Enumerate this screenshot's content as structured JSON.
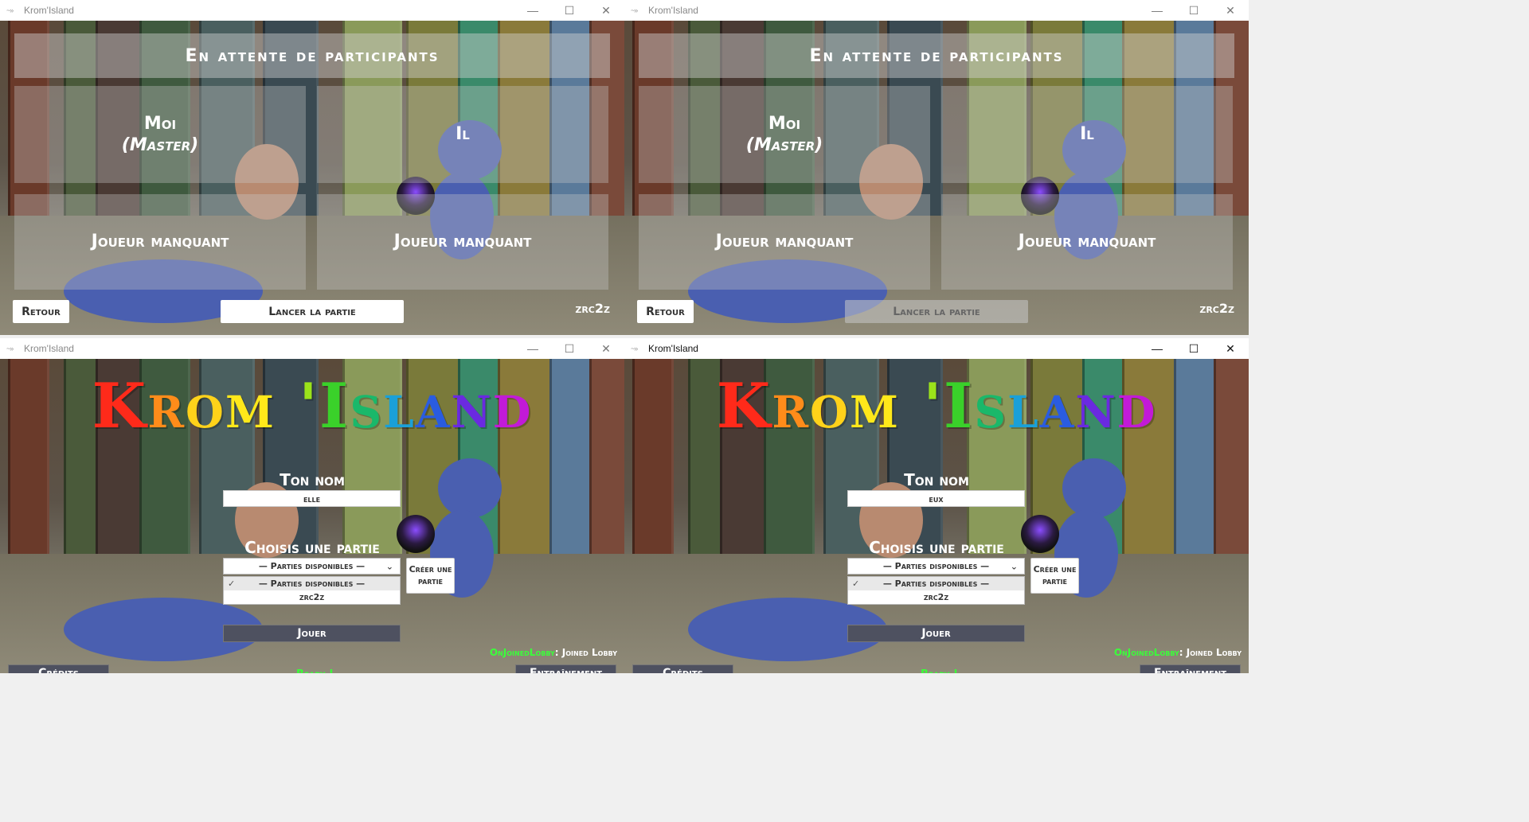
{
  "app_title": "Krom'Island",
  "window_controls": {
    "minimize": "—",
    "maximize": "☐",
    "close": "✕"
  },
  "lobby": {
    "header": "En attente de participants",
    "slots": [
      "Moi",
      "(Master)",
      "Il",
      "Joueur manquant",
      "Joueur manquant"
    ],
    "back_label": "Retour",
    "launch_label": "Lancer la partie",
    "room_code": "zrc2z"
  },
  "menu": {
    "title_letters": [
      {
        "ch": "K",
        "color": "#ff2a1a"
      },
      {
        "ch": "r",
        "color": "#ff8c1a"
      },
      {
        "ch": "o",
        "color": "#ffd21a"
      },
      {
        "ch": "m",
        "color": "#ffe81a"
      },
      {
        "ch": " ",
        "color": "#ffffff"
      },
      {
        "ch": "'",
        "color": "#9be31a"
      },
      {
        "ch": "I",
        "color": "#3ad12a"
      },
      {
        "ch": "s",
        "color": "#1ab86a"
      },
      {
        "ch": "l",
        "color": "#1aa0d8"
      },
      {
        "ch": "a",
        "color": "#2a5ce0"
      },
      {
        "ch": "n",
        "color": "#6a2ae0"
      },
      {
        "ch": "d",
        "color": "#c21ad8"
      }
    ],
    "name_label": "Ton nom",
    "choose_label": "Choisis une partie",
    "select_value": "— Parties disponibles —",
    "dropdown_options": [
      "— Parties disponibles —",
      "zrc2z"
    ],
    "create_line1": "Créer une",
    "create_line2": "partie",
    "play_label": "Jouer",
    "credits_label": "Crédits",
    "training_label": "Entraînement",
    "status_key": "OnJoinedLobby",
    "status_value": ": Joined Lobby",
    "ready_label": "Ready !"
  },
  "windows": [
    {
      "name": "lobby-window-master",
      "launch_enabled": true,
      "active": false
    },
    {
      "name": "lobby-window-guest",
      "launch_enabled": false,
      "active": false
    },
    {
      "name": "menu-window-elle",
      "player_name": "elle",
      "active": false
    },
    {
      "name": "menu-window-eux",
      "player_name": "eux",
      "active": true
    }
  ],
  "colors": {
    "accent_green": "#3aff3a",
    "dark_button": "#4e5160"
  }
}
